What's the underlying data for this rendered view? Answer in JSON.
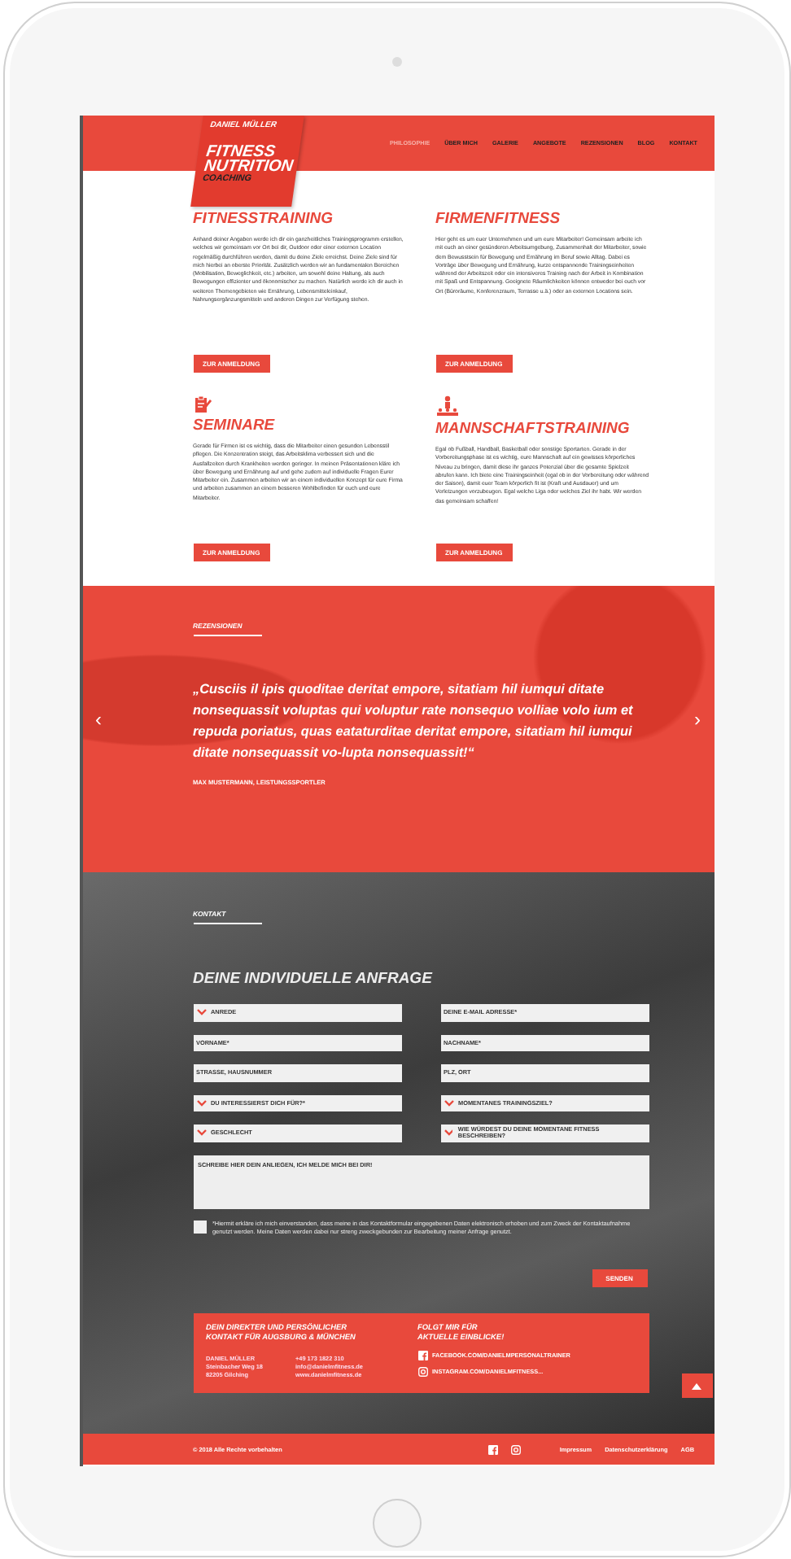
{
  "header": {
    "logo": {
      "name": "DANIEL MÜLLER",
      "lines": [
        "FITNESS",
        "NUTRITION",
        "COACHING"
      ]
    },
    "nav": [
      {
        "label": "PHILOSOPHIE",
        "selected": true
      },
      {
        "label": "ÜBER MICH",
        "selected": false
      },
      {
        "label": "GALERIE",
        "selected": false
      },
      {
        "label": "ANGEBOTE",
        "selected": false
      },
      {
        "label": "REZENSIONEN",
        "selected": false
      },
      {
        "label": "BLOG",
        "selected": false
      },
      {
        "label": "KONTAKT",
        "selected": false
      }
    ]
  },
  "services": [
    {
      "title": "FITNESSTRAINING",
      "text": "Anhand deiner Angaben werde ich dir ein ganzheitliches Trainingsprogramm erstellen, welches wir gemeinsam vor Ort bei dir, Outdoor oder einer externen Location regelmäßig durchführen werden, damit du deine Ziele erreichst. Deine Ziele sind für mich hierbei an oberste Priorität. Zusätzlich werden wir an fundamentalen Bereichen (Mobilisation, Beweglichkeit, etc.) arbeiten, um sowohl deine Haltung, als auch Bewegungen effizienter und ökonomischer zu machen. Natürlich werde ich dir auch in weiteren Themengebieten wie Ernährung, Lebensmitteleinkauf, Nahrungsergänzungsmitteln und anderen Dingen zur Verfügung stehen.",
      "button": "ZUR ANMELDUNG"
    },
    {
      "title": "FIRMENFITNESS",
      "text": "Hier geht es um euer Unternehmen und um eure Mitarbeiter! Gemeinsam arbeite ich mit euch an einer gesünderen Arbeitsumgebung, Zusammenhalt der Mitarbeiter, sowie dem Bewusstsein für Bewegung und Ernährung im Beruf sowie Alltag. Dabei es Vorträge über Bewegung und Ernährung, kurze entspannende Trainingseinheiten während der Arbeitszeit oder ein intensiveres Training nach der Arbeit in Kombination mit Spaß und Entspannung. Geeignete Räumlichkeiten können entweder bei euch vor Ort (Büroräume, Konferenzraum, Terrasse u.ä.) oder an externen Locations sein.",
      "button": "ZUR ANMELDUNG"
    },
    {
      "title": "SEMINARE",
      "text": "Gerade für Firmen ist es wichtig, dass die Mitarbeiter einen gesunden Lebensstil pflegen. Die Konzentration steigt, das Arbeitsklima verbessert sich und die Ausfallzeiten durch Krankheiten werden geringer. In meinen Präsentationen kläre ich über Bewegung und Ernährung auf und gehe zudem auf individuelle Fragen Eurer Mitarbeiter ein. Zusammen arbeiten wir an einem individuellen Konzept für eure Firma und arbeiten zusammen an einem besseren Wohlbefinden für euch und eure Mitarbeiter.",
      "button": "ZUR ANMELDUNG"
    },
    {
      "title": "MANNSCHAFTSTRAINING",
      "text": "Egal ob Fußball, Handball, Basketball oder sonstige Sportarten. Gerade in der Vorbereitungsphase ist es wichtig, eure Mannschaft auf ein gewisses körperliches Niveau zu bringen, damit diese ihr ganzes Potenzial über die gesamte Spielzeit abrufen kann. Ich biete eine Trainingseinheit (egal ob in der Vorbereitung oder während der Saison), damit euer Team körperlich fit ist (Kraft und Ausdauer) und um Verletzungen vorzubeugen. Egal welche Liga oder welches Ziel ihr habt. Wir werden das gemeinsam schaffen!",
      "button": "ZUR ANMELDUNG"
    }
  ],
  "testimonial": {
    "label": "REZENSIONEN",
    "quote": "„Cusciis il ipis quoditae deritat empore, sitatiam hil iumqui ditate nonsequassit voluptas qui voluptur rate nonsequo volliae volo ium et repuda poriatus, quas eataturditae deritat empore, sitatiam hil iumqui ditate nonsequassit vo-lupta nonsequassit!“",
    "author": "MAX MUSTERMANN, LEISTUNGSSPORTLER",
    "prev": "‹",
    "next": "›"
  },
  "contact": {
    "label": "KONTAKT",
    "title": "DEINE INDIVIDUELLE ANFRAGE",
    "fields": [
      {
        "kind": "select",
        "label": "ANREDE"
      },
      {
        "kind": "text",
        "label": "DEINE E-MAIL ADRESSE*"
      },
      {
        "kind": "text",
        "label": "VORNAME*"
      },
      {
        "kind": "text",
        "label": "NACHNAME*"
      },
      {
        "kind": "text",
        "label": "STRASSE, HAUSNUMMER"
      },
      {
        "kind": "text",
        "label": "PLZ, ORT"
      },
      {
        "kind": "select",
        "label": "DU INTERESSIERST DICH FÜR?*"
      },
      {
        "kind": "select",
        "label": "MOMENTANES TRAININGSZIEL?"
      },
      {
        "kind": "select",
        "label": "GESCHLECHT"
      },
      {
        "kind": "select",
        "label": "WIE WÜRDEST DU DEINE MOMENTANE FITNESS BESCHREIBEN?"
      }
    ],
    "message_placeholder": "SCHREIBE HIER DEIN ANLIEGEN, ICH MELDE MICH BEI DIR!",
    "consent": {
      "checked": false,
      "text": "*Hiermit erkläre ich mich einverstanden, dass meine in das Kontaktformular eingegebenen Daten elektronisch erhoben und zum Zweck der Kontaktaufnahme genutzt werden. Meine Daten werden dabei nur streng zweckgebunden zur Bearbeitung meiner Anfrage genutzt."
    },
    "submit": "SENDEN"
  },
  "footer_box": {
    "heading": "DEIN DIREKTER UND PERSÖNLICHER KONTAKT FÜR AUGSBURG & MÜNCHEN",
    "address": [
      "DANIEL MÜLLER",
      "Steinbacher Weg 18",
      "82205 Gilching"
    ],
    "reach": [
      "+49 173 1822 310",
      "info@danielmfitness.de",
      "www.danielmfitness.de"
    ],
    "follow_heading": "FOLGT MIR FÜR AKTUELLE EINBLICKE!",
    "social": [
      {
        "kind": "facebook",
        "text": "FACEBOOK.COM/DANIELMPERSONALTRAINER"
      },
      {
        "kind": "instagram",
        "text": "INSTAGRAM.COM/DANIELMFITNESS..."
      }
    ]
  },
  "bottom_bar": {
    "copyright": "© 2018 Alle Rechte vorbehalten",
    "social": [
      {
        "kind": "facebook"
      },
      {
        "kind": "instagram"
      }
    ],
    "links": [
      "Impressum",
      "Datenschutzerklärung",
      "AGB"
    ]
  }
}
